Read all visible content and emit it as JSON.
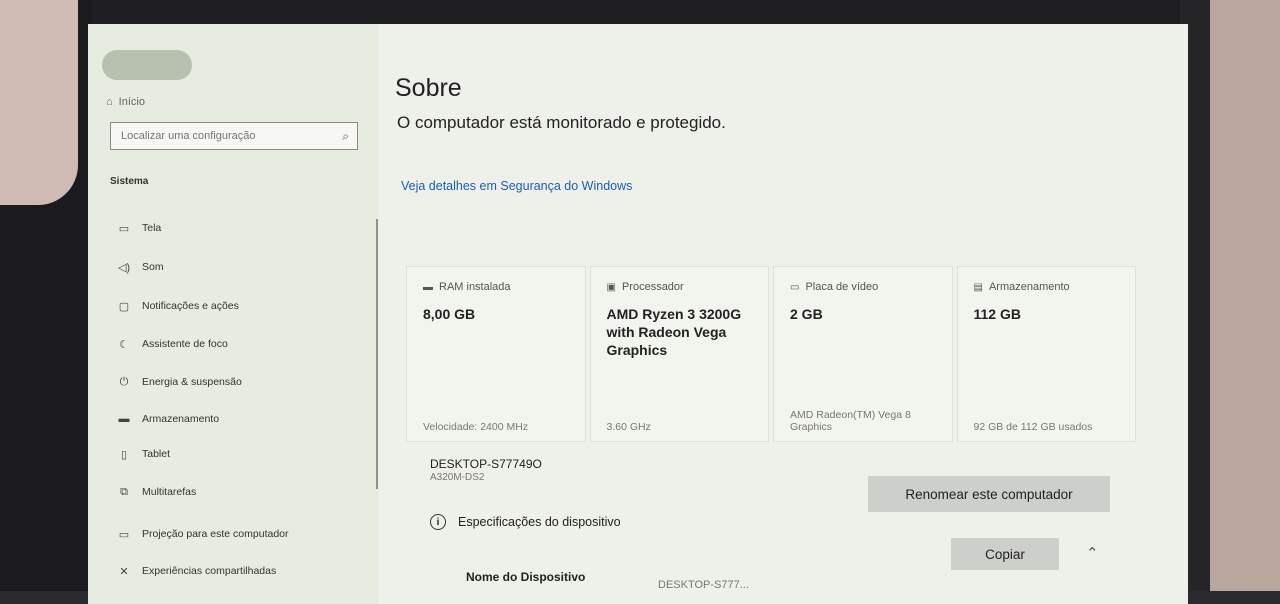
{
  "sidebar": {
    "home_label": "Início",
    "search_placeholder": "Localizar uma configuração",
    "section": "Sistema",
    "items": [
      {
        "label": "Tela",
        "icon": "monitor-icon"
      },
      {
        "label": "Som",
        "icon": "speaker-icon"
      },
      {
        "label": "Notificações e ações",
        "icon": "notification-icon"
      },
      {
        "label": "Assistente de foco",
        "icon": "moon-icon"
      },
      {
        "label": "Energia & suspensão",
        "icon": "power-icon"
      },
      {
        "label": "Armazenamento",
        "icon": "storage-icon"
      },
      {
        "label": "Tablet",
        "icon": "tablet-icon"
      },
      {
        "label": "Multitarefas",
        "icon": "multitask-icon"
      },
      {
        "label": "Projeção para este computador",
        "icon": "projection-icon"
      },
      {
        "label": "Experiências compartilhadas",
        "icon": "shared-icon"
      }
    ]
  },
  "main": {
    "title": "Sobre",
    "status": "O computador está monitorado e protegido.",
    "security_link": "Veja detalhes em Segurança do Windows",
    "cards": [
      {
        "label": "RAM instalada",
        "icon": "ram-icon",
        "value": "8,00 GB",
        "sub": "Velocidade: 2400 MHz"
      },
      {
        "label": "Processador",
        "icon": "cpu-icon",
        "value": "AMD Ryzen 3 3200G with Radeon Vega Graphics",
        "sub": "3.60 GHz"
      },
      {
        "label": "Placa de vídeo",
        "icon": "gpu-icon",
        "value": "2 GB",
        "sub": "AMD Radeon(TM) Vega 8 Graphics"
      },
      {
        "label": "Armazenamento",
        "icon": "disk-icon",
        "value": "112 GB",
        "sub": "92 GB de 112 GB usados"
      }
    ],
    "device_name": "DESKTOP-S77749O",
    "device_model": "A320M-DS2",
    "rename_label": "Renomear este computador",
    "specs_heading": "Especificações do dispositivo",
    "copy_label": "Copiar",
    "device_name_label": "Nome do Dispositivo",
    "device_name_value": "DESKTOP-S777..."
  }
}
